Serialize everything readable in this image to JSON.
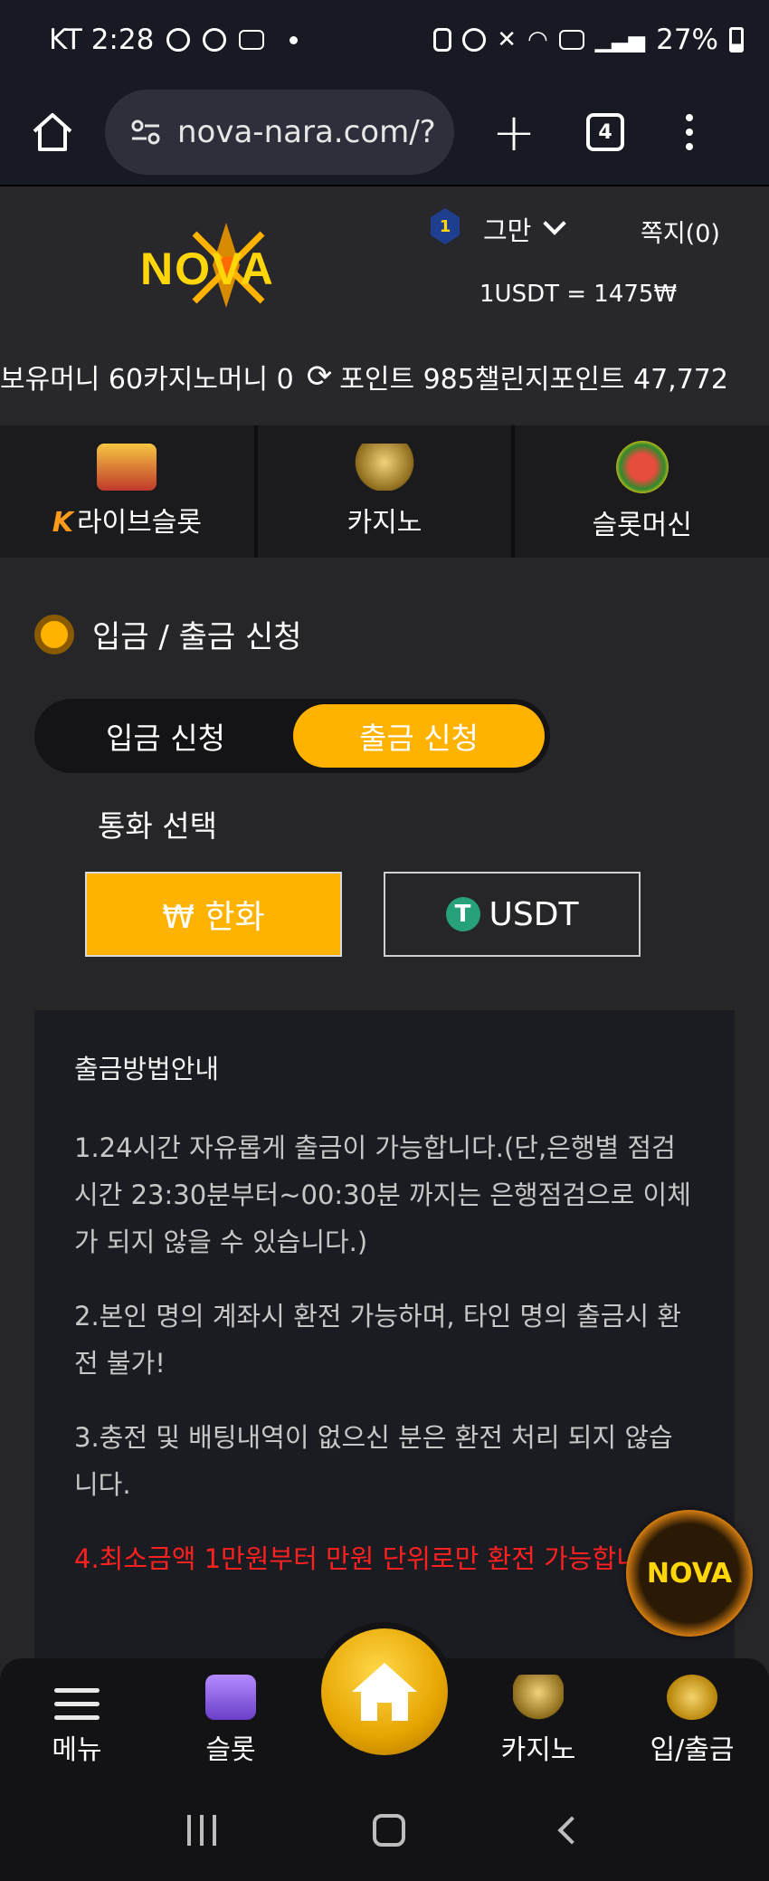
{
  "status_bar": {
    "carrier_time": "KT 2:28",
    "battery": "27%"
  },
  "browser": {
    "url": "nova-nara.com/?",
    "tab_count": "4"
  },
  "header": {
    "logo_text": "NOVA",
    "level": "1",
    "username": "그만",
    "messages_label": "쪽지(0)",
    "rate": "1USDT = 1475₩"
  },
  "balances": {
    "held_money": "보유머니 60",
    "casino_money": "카지노머니 0",
    "points": "포인트 985",
    "challenge_points": "챌린지포인트 47,772"
  },
  "categories": [
    {
      "label": "라이브슬롯",
      "prefix": "K"
    },
    {
      "label": "카지노"
    },
    {
      "label": "슬롯머신"
    }
  ],
  "section_title": "입금 / 출금 신청",
  "segment": {
    "deposit": "입금 신청",
    "withdraw": "출금 신청"
  },
  "currency": {
    "label": "통화 선택",
    "krw": "₩ 한화",
    "usdt": "USDT"
  },
  "guide": {
    "title": "출금방법안내",
    "items": [
      "1.24시간 자유롭게 출금이 가능합니다.(단,은행별 점검시간 23:30분부터~00:30분 까지는 은행점검으로 이체가 되지 않을 수 있습니다.)",
      "2.본인 명의 계좌시 환전 가능하며, 타인 명의 출금시 환전 불가!",
      "3.충전 및 배팅내역이 없으신 분은 환전 처리 되지 않습니다.",
      "4.최소금액 1만원부터 만원 단위로만 환전 가능합니다."
    ]
  },
  "fab_text": "NOVA",
  "bottom_nav": {
    "menu": "메뉴",
    "slot": "슬롯",
    "casino": "카지노",
    "inout": "입/출금"
  },
  "colors": {
    "accent": "#ffb300",
    "warning": "#ff2020",
    "background": "#262629"
  }
}
